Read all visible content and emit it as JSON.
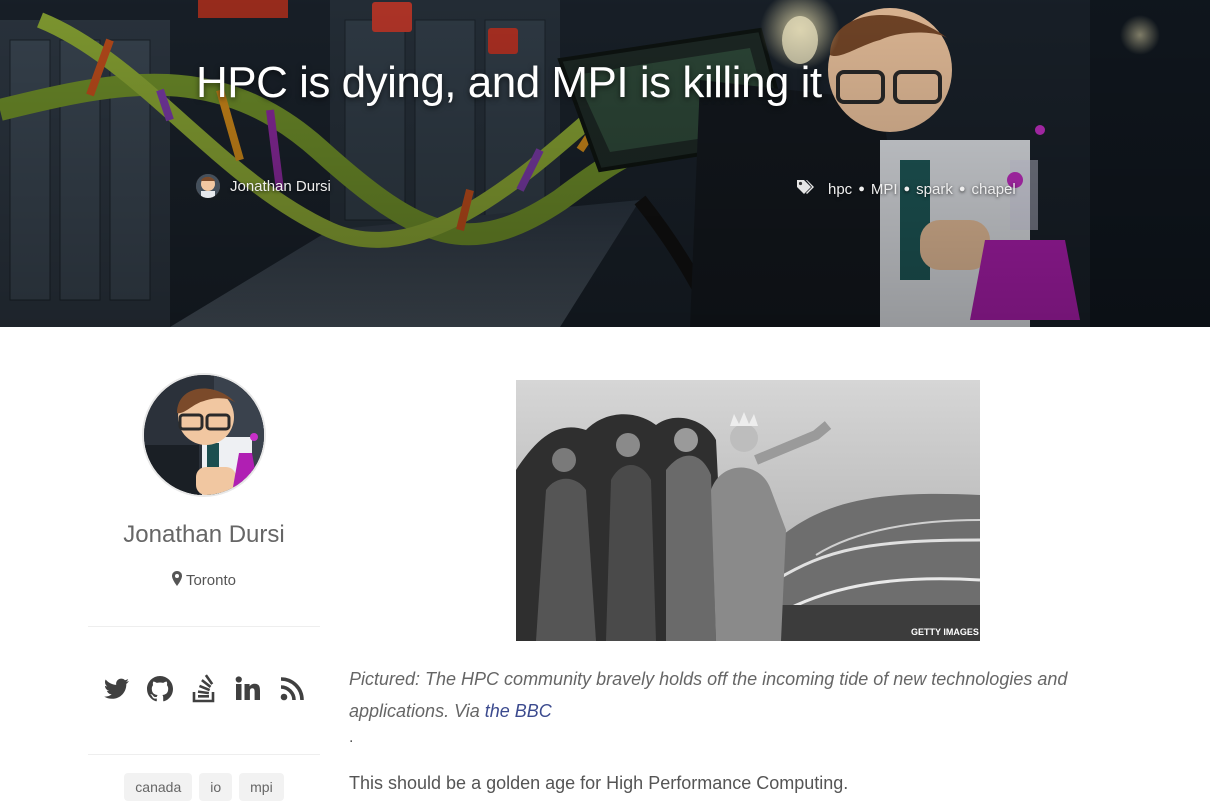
{
  "post": {
    "title": "HPC is dying, and MPI is killing it",
    "author": "Jonathan Dursi",
    "tags": [
      "hpc",
      "MPI",
      "spark",
      "chapel"
    ]
  },
  "sidebar": {
    "name": "Jonathan Dursi",
    "location": "Toronto",
    "social_icons": [
      "twitter-icon",
      "github-icon",
      "stackoverflow-icon",
      "linkedin-icon",
      "rss-icon"
    ],
    "tags": [
      "canada",
      "io",
      "mpi"
    ]
  },
  "article": {
    "image_watermark": "GETTY IMAGES",
    "caption_text": "Pictured: The HPC community bravely holds off the incoming tide of new technologies and applications. Via ",
    "caption_link": "the BBC",
    "dot": ".",
    "first_paragraph": "This should be a golden age for High Performance Computing."
  },
  "colors": {
    "link": "#3b4a8e",
    "text": "#555555",
    "hero_dark": "#1c2630"
  }
}
